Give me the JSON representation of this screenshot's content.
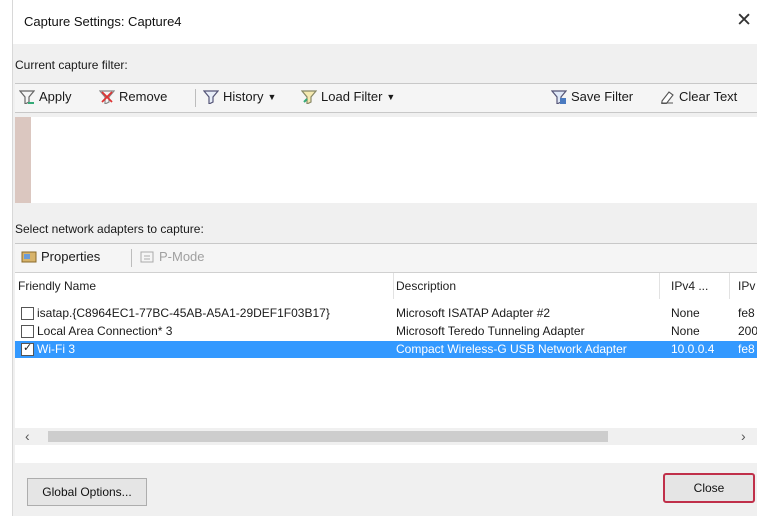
{
  "window": {
    "title": "Capture Settings: Capture4"
  },
  "filter_section": {
    "label": "Current capture filter:"
  },
  "filter_toolbar": {
    "apply": "Apply",
    "remove": "Remove",
    "history": "History",
    "load_filter": "Load Filter",
    "save_filter": "Save Filter",
    "clear_text": "Clear Text"
  },
  "adapters_section": {
    "label": "Select network adapters to capture:"
  },
  "adapter_toolbar": {
    "properties": "Properties",
    "pmode": "P-Mode"
  },
  "columns": {
    "friendly_name": "Friendly Name",
    "description": "Description",
    "ipv4": "IPv4 ...",
    "ipv6": "IPv"
  },
  "adapters": [
    {
      "checked": false,
      "friendly_name": "isatap.{C8964EC1-77BC-45AB-A5A1-29DEF1F03B17}",
      "description": "Microsoft ISATAP Adapter #2",
      "ipv4": "None",
      "ipv6": "fe8"
    },
    {
      "checked": false,
      "friendly_name": "Local Area Connection* 3",
      "description": "Microsoft Teredo Tunneling Adapter",
      "ipv4": "None",
      "ipv6": "200"
    },
    {
      "checked": true,
      "friendly_name": "Wi-Fi 3",
      "description": "Compact Wireless-G USB Network Adapter",
      "ipv4": "10.0.0.4",
      "ipv6": "fe8"
    }
  ],
  "buttons": {
    "global_options": "Global Options...",
    "close": "Close"
  },
  "colors": {
    "selection": "#3399ff",
    "focus_border": "#c0304a"
  }
}
